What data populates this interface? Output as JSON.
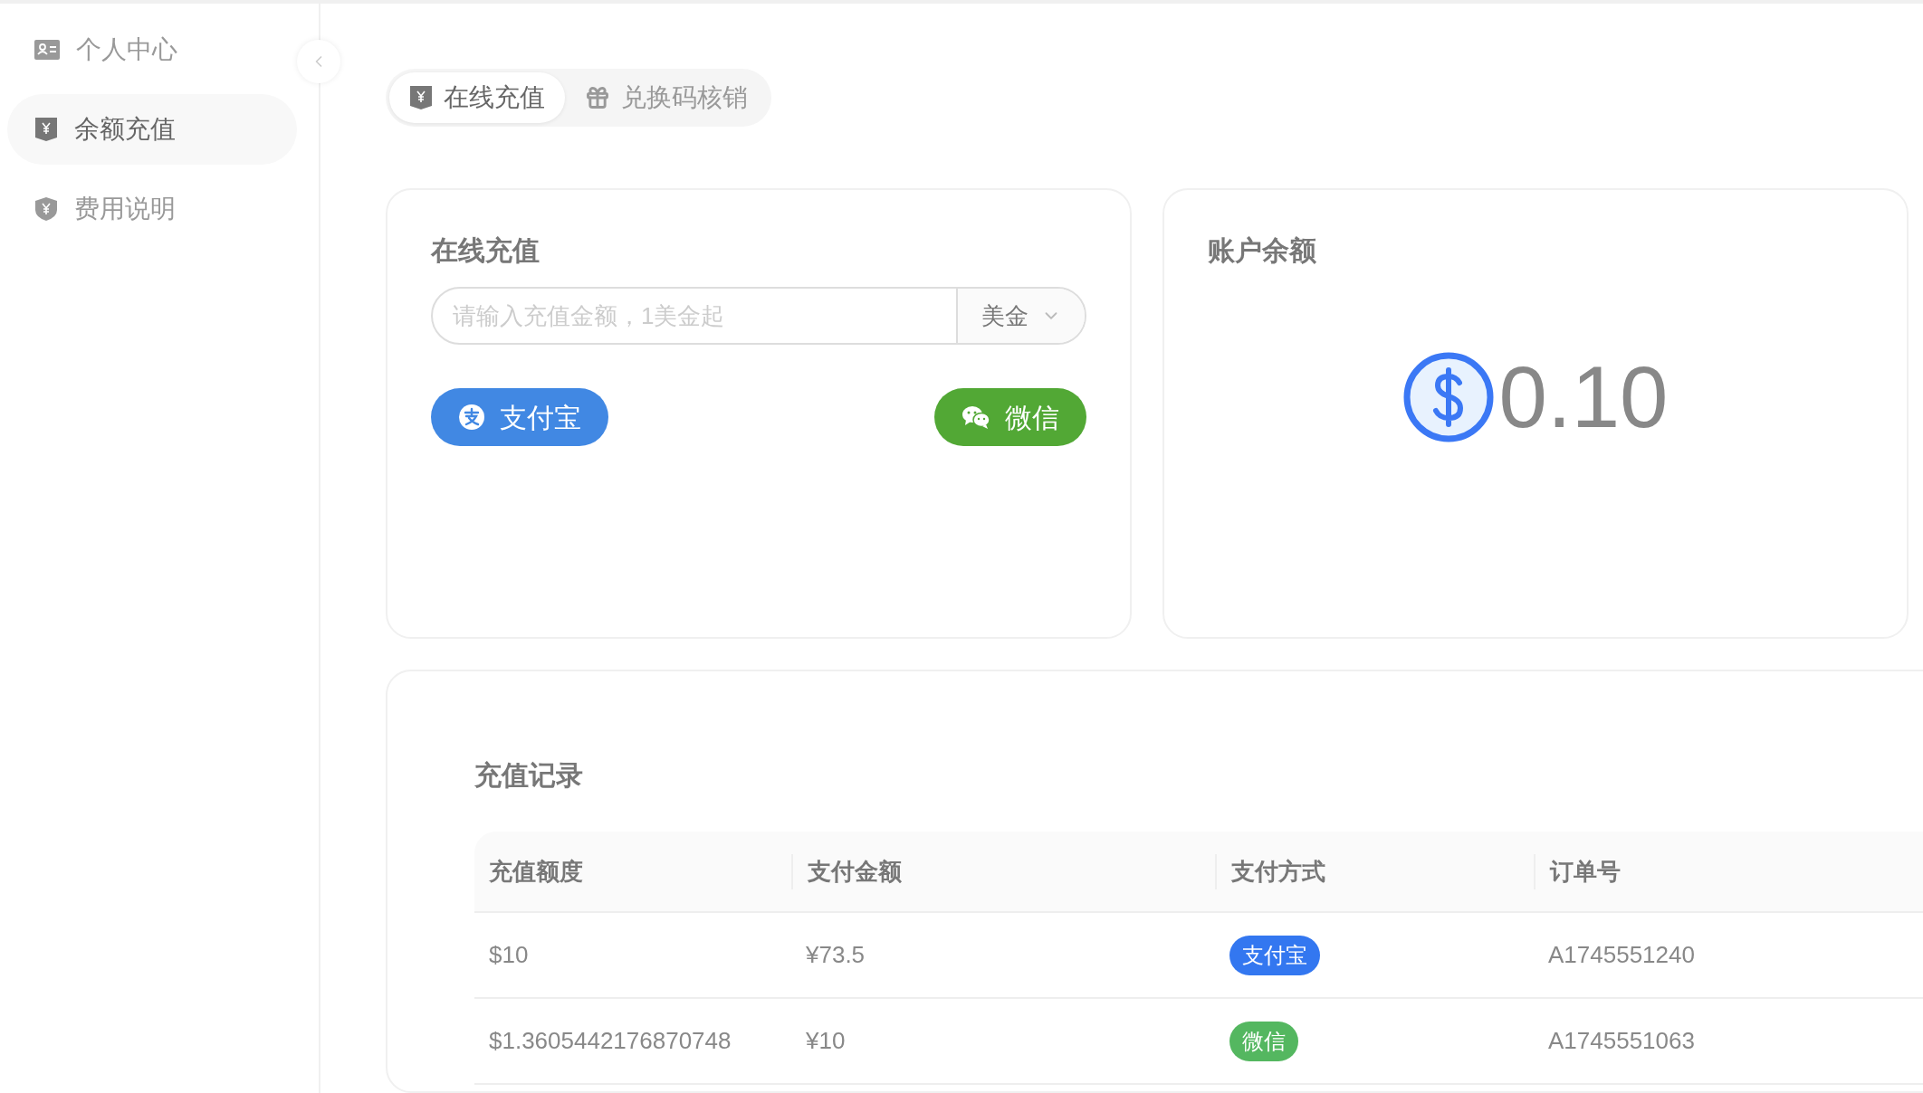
{
  "sidebar": {
    "items": [
      {
        "label": "个人中心",
        "kind": "profile",
        "selected": false
      },
      {
        "label": "余额充值",
        "kind": "recharge",
        "selected": true
      },
      {
        "label": "费用说明",
        "kind": "pricing",
        "selected": false
      }
    ]
  },
  "tabs": [
    {
      "label": "在线充值",
      "kind": "recharge",
      "selected": true
    },
    {
      "label": "兑换码核销",
      "kind": "redeem",
      "selected": false
    }
  ],
  "recharge_card": {
    "title": "在线充值",
    "amount_field": {
      "placeholder": "请输入充值金额，1美金起"
    },
    "currency_select": {
      "value": "美金"
    },
    "buttons": [
      {
        "label": "支付宝",
        "kind": "alipay"
      },
      {
        "label": "微信",
        "kind": "wechat"
      }
    ]
  },
  "balance_card": {
    "title": "账户余额",
    "amount": "0.10"
  },
  "records": {
    "title": "充值记录",
    "columns": [
      "充值额度",
      "支付金额",
      "支付方式",
      "订单号"
    ],
    "rows": [
      {
        "credit": "$10",
        "paid": "¥73.5",
        "method": {
          "label": "支付宝",
          "kind": "alipay"
        },
        "order": "A1745551240"
      },
      {
        "credit": "$1.3605442176870748",
        "paid": "¥10",
        "method": {
          "label": "微信",
          "kind": "wechat"
        },
        "order": "A1745551063"
      }
    ]
  }
}
